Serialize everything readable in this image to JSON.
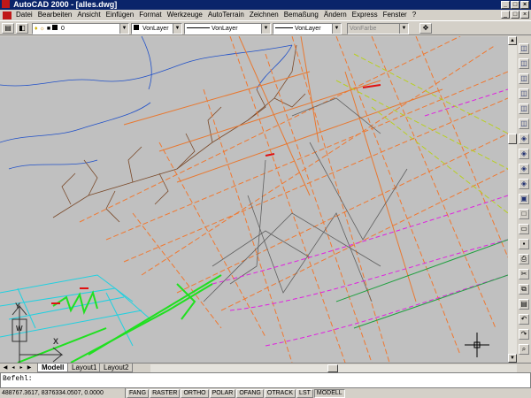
{
  "window": {
    "title": "AutoCAD 2000 - [alles.dwg]",
    "controls": [
      "_",
      "□",
      "×"
    ]
  },
  "doc_controls": [
    "_",
    "□",
    "×"
  ],
  "menu": [
    "Datei",
    "Bearbeiten",
    "Ansicht",
    "Einfügen",
    "Format",
    "Werkzeuge",
    "AutoTerrain",
    "Zeichnen",
    "Bemaßung",
    "Ändern",
    "Express",
    "Fenster",
    "?"
  ],
  "toolbar": {
    "layer_value": "0",
    "color_value": "VonLayer",
    "linetype_value": "VonLayer",
    "lineweight_value": "VonLayer",
    "plotstyle_value": "VonFarbe"
  },
  "tabs": [
    "Modell",
    "Layout1",
    "Layout2"
  ],
  "active_tab": "Modell",
  "command": {
    "prompt": "Befehl:"
  },
  "status": {
    "coordinates": "488767.3617, 8376334.0507, 0.0000",
    "toggles": [
      "FANG",
      "RASTER",
      "ORTHO",
      "POLAR",
      "OFANG",
      "OTRACK",
      "LST",
      "MODELL"
    ],
    "active": [
      "MODELL"
    ]
  },
  "ucs": {
    "y_label": "Y",
    "w_label": "W",
    "x_label": "X"
  },
  "colors": {
    "title_bg": "#0a246a",
    "canvas_bg": "#c0c0c0",
    "orange": "#f07830",
    "blue": "#2050c8",
    "green": "#20e020",
    "cyan": "#20d0e0",
    "magenta": "#e020e0",
    "gray": "#606060"
  }
}
